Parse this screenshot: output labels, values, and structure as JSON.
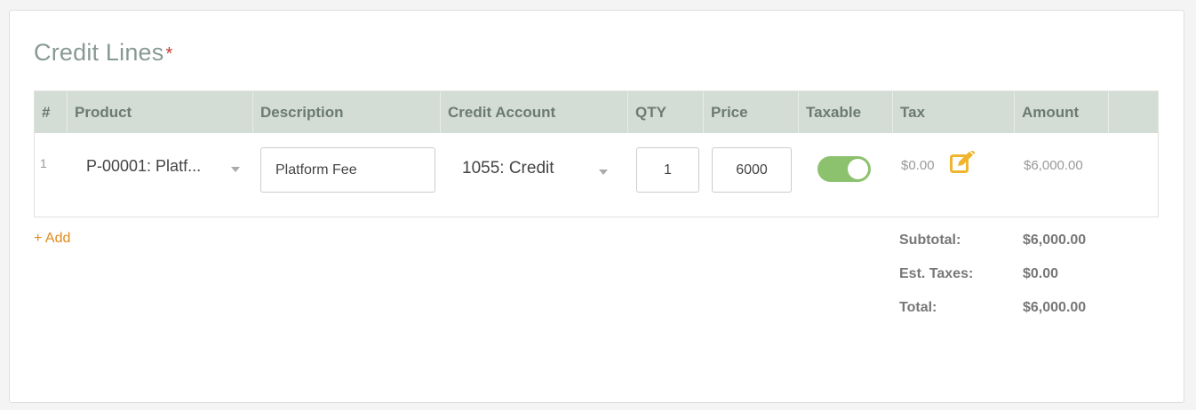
{
  "section": {
    "title": "Credit Lines",
    "required_marker": "*"
  },
  "table": {
    "columns": [
      "#",
      "Product",
      "Description",
      "Credit Account",
      "QTY",
      "Price",
      "Taxable",
      "Tax",
      "Amount"
    ],
    "rows": [
      {
        "index": "1",
        "product": "P-00001: Platf...",
        "description": "Platform Fee",
        "credit_account": "1055: Credit",
        "qty": "1",
        "price": "6000",
        "taxable": true,
        "tax": "$0.00",
        "amount": "$6,000.00"
      }
    ]
  },
  "add_label": "+ Add",
  "totals": {
    "subtotal_label": "Subtotal:",
    "subtotal_value": "$6,000.00",
    "taxes_label": "Est. Taxes:",
    "taxes_value": "$0.00",
    "total_label": "Total:",
    "total_value": "$6,000.00"
  },
  "colors": {
    "accent": "#e08a1e",
    "toggle_on": "#8cc26e",
    "header_bg": "#d3ddd5",
    "edit_icon": "#f0b52c",
    "required": "#c0392b"
  },
  "icons": {
    "edit": "edit-pencil-icon",
    "dropdown": "chevron-down-icon"
  }
}
